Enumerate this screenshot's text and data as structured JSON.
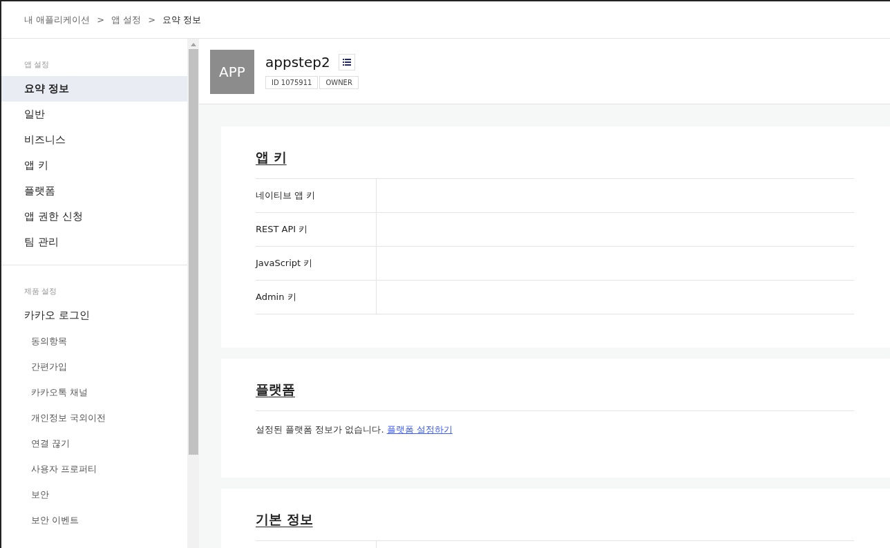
{
  "breadcrumb": [
    {
      "label": "내 애플리케이션",
      "current": false
    },
    {
      "separator": ">",
      "label": "앱 설정",
      "current": false
    },
    {
      "separator": ">",
      "label": "요약 정보",
      "current": true
    }
  ],
  "sidebar": {
    "sections": [
      {
        "title": "앱 설정",
        "items": [
          {
            "label": "요약 정보",
            "selected": true
          },
          {
            "label": "일반",
            "selected": false
          },
          {
            "label": "비즈니스",
            "selected": false
          },
          {
            "label": "앱 키",
            "selected": false
          },
          {
            "label": "플랫폼",
            "selected": false
          },
          {
            "label": "앱 권한 신청",
            "selected": false
          },
          {
            "label": "팀 관리",
            "selected": false
          }
        ]
      },
      {
        "title": "제품 설정",
        "items": [
          {
            "label": "카카오 로그인",
            "selected": false,
            "children": [
              {
                "label": "동의항목",
                "selected": false
              },
              {
                "label": "간편가입",
                "selected": false
              },
              {
                "label": "카카오톡 채널",
                "selected": false
              },
              {
                "label": "개인정보 국외이전",
                "selected": false
              },
              {
                "label": "연결 끊기",
                "selected": false
              },
              {
                "label": "사용자 프로퍼티",
                "selected": false
              },
              {
                "label": "보안",
                "selected": false
              },
              {
                "label": "보안 이벤트",
                "selected": false
              }
            ]
          }
        ]
      }
    ]
  },
  "app": {
    "icon_text": "APP",
    "name": "appstep2",
    "badges": [
      "ID 1075911",
      "OWNER"
    ]
  },
  "cards": [
    {
      "kind": "table",
      "title": "앱 키",
      "rows": [
        {
          "label": "네이티브 앱 키"
        },
        {
          "label": "REST API 키"
        },
        {
          "label": "JavaScript 키"
        },
        {
          "label": "Admin 키"
        }
      ]
    },
    {
      "kind": "message",
      "title": "플랫폼",
      "text": "설정된 플랫폼 정보가 없습니다.",
      "link": "플랫폼 설정하기"
    },
    {
      "kind": "table",
      "title": "기본 정보"
    }
  ]
}
